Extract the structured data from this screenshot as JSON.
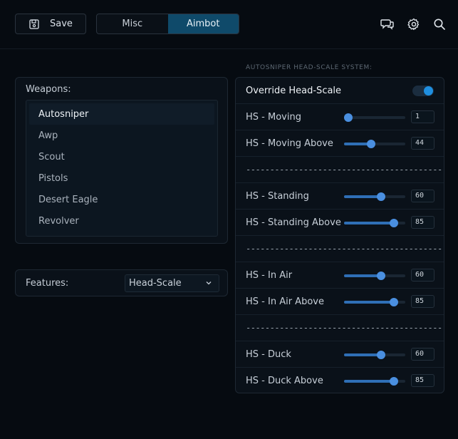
{
  "toolbar": {
    "save_label": "Save"
  },
  "tabs": [
    {
      "label": "Misc",
      "active": false
    },
    {
      "label": "Aimbot",
      "active": true
    }
  ],
  "top_icons": [
    "chat-icon",
    "gear-icon",
    "search-icon"
  ],
  "weapons": {
    "label": "Weapons:",
    "items": [
      "Autosniper",
      "Awp",
      "Scout",
      "Pistols",
      "Desert Eagle",
      "Revolver"
    ],
    "selected": "Autosniper"
  },
  "features": {
    "label": "Features:",
    "selected": "Head-Scale"
  },
  "headscale": {
    "section_title": "AUTOSNIPER HEAD-SCALE SYSTEM:",
    "override_label": "Override Head-Scale",
    "override_on": true,
    "separator": "-----------------------------------------",
    "rows": [
      {
        "label": "HS - Moving",
        "value": "1",
        "percent": 0.07
      },
      {
        "label": "HS - Moving Above",
        "value": "44",
        "percent": 0.44
      },
      {
        "label": "HS - Standing",
        "value": "60",
        "percent": 0.6
      },
      {
        "label": "HS - Standing Above",
        "value": "85",
        "percent": 0.81
      },
      {
        "label": "HS - In Air",
        "value": "60",
        "percent": 0.6
      },
      {
        "label": "HS - In Air Above",
        "value": "85",
        "percent": 0.81
      },
      {
        "label": "HS - Duck",
        "value": "60",
        "percent": 0.6
      },
      {
        "label": "HS - Duck Above",
        "value": "85",
        "percent": 0.81
      }
    ]
  },
  "colors": {
    "accent": "#0f4a6a",
    "slider": "#4a8fe0",
    "toggle": "#1f8fe0"
  }
}
